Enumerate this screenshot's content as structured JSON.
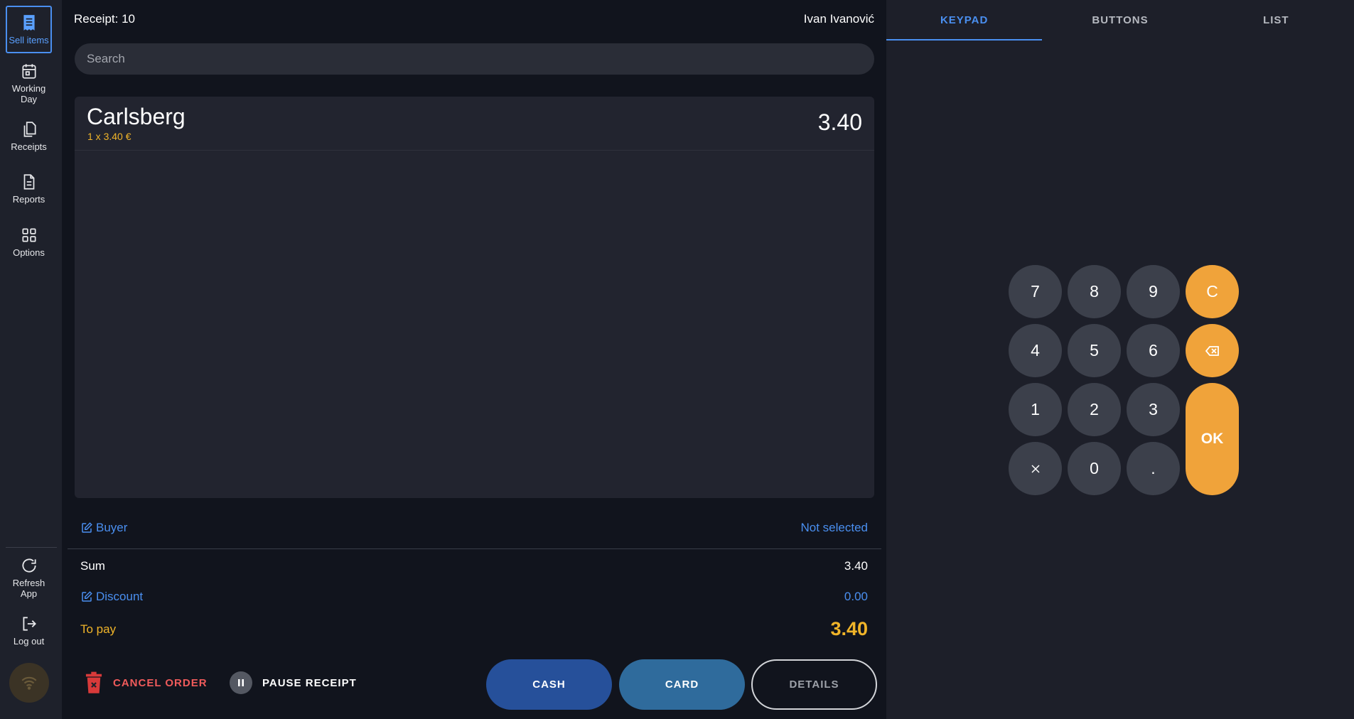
{
  "sidebar": {
    "items": [
      {
        "label": "Sell items",
        "icon": "receipt-icon"
      },
      {
        "label": "Working Day",
        "icon": "calendar-icon"
      },
      {
        "label": "Receipts",
        "icon": "documents-icon"
      },
      {
        "label": "Reports",
        "icon": "report-icon"
      },
      {
        "label": "Options",
        "icon": "grid-icon"
      }
    ],
    "bottom_items": [
      {
        "label": "Refresh App",
        "icon": "refresh-icon"
      },
      {
        "label": "Log out",
        "icon": "logout-icon"
      }
    ],
    "connection_icon": "wifi-icon"
  },
  "header": {
    "receipt_title": "Receipt: 10",
    "user_name": "Ivan Ivanović"
  },
  "search": {
    "placeholder": "Search",
    "value": ""
  },
  "items": [
    {
      "name": "Carlsberg",
      "detail": "1 x 3.40 €",
      "price": "3.40"
    }
  ],
  "summary": {
    "buyer_label": "Buyer",
    "buyer_value": "Not selected",
    "sum_label": "Sum",
    "sum_value": "3.40",
    "discount_label": "Discount",
    "discount_value": "0.00",
    "to_pay_label": "To pay",
    "to_pay_value": "3.40"
  },
  "actions": {
    "cancel_order": "CANCEL ORDER",
    "pause_receipt": "PAUSE RECEIPT",
    "cash": "CASH",
    "card": "CARD",
    "details": "DETAILS"
  },
  "tabs": [
    {
      "label": "KEYPAD",
      "active": true
    },
    {
      "label": "BUTTONS",
      "active": false
    },
    {
      "label": "LIST",
      "active": false
    }
  ],
  "keypad": {
    "k7": "7",
    "k8": "8",
    "k9": "9",
    "clear": "C",
    "k4": "4",
    "k5": "5",
    "k6": "6",
    "k1": "1",
    "k2": "2",
    "k3": "3",
    "ok": "OK",
    "k0": "0",
    "dot": "."
  },
  "colors": {
    "accent": "#4a8ff0",
    "warning": "#f0b429",
    "keypad_orange": "#f0a33a",
    "danger": "#f05b5b"
  }
}
